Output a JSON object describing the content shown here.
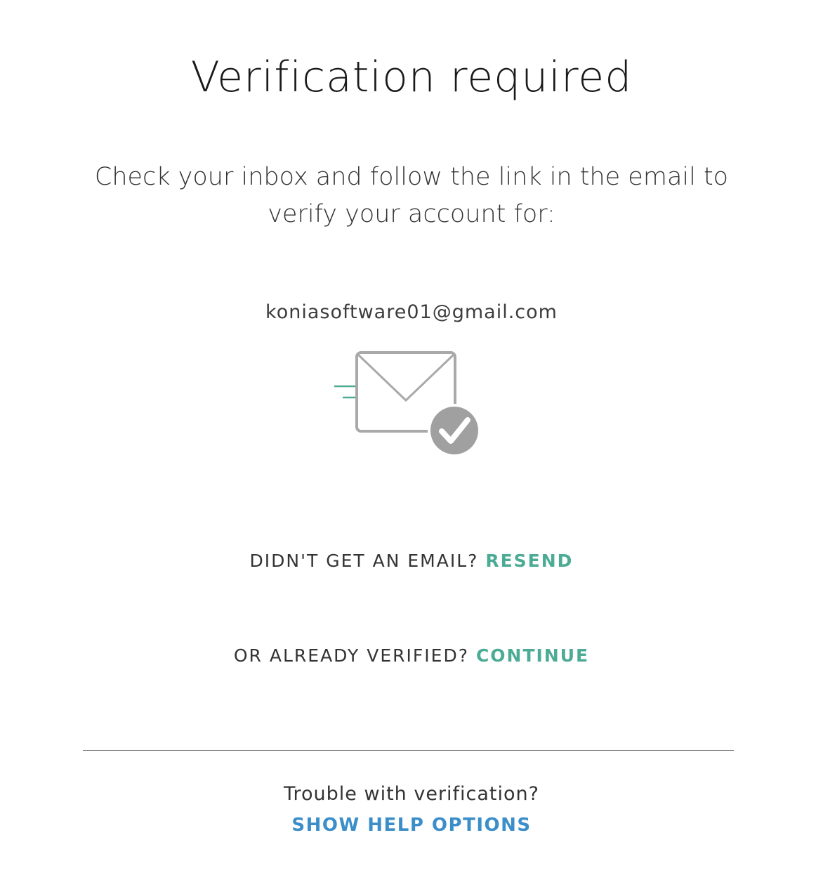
{
  "page": {
    "title": "Verification required",
    "instructions": "Check your inbox and follow the link in the email to verify your account for:",
    "email": "koniasoftware01@gmail.com"
  },
  "illustration": {
    "icon": "envelope-check-icon",
    "accent_color": "#4cab95",
    "outline_color": "#a9a9a9"
  },
  "resend": {
    "prompt": "DIDN'T GET AN EMAIL?",
    "link_label": "RESEND"
  },
  "continue": {
    "prompt": "OR ALREADY VERIFIED?",
    "link_label": "CONTINUE"
  },
  "help": {
    "prompt": "Trouble with verification?",
    "link_label": "SHOW HELP OPTIONS",
    "link_color": "#3b8ec9"
  }
}
